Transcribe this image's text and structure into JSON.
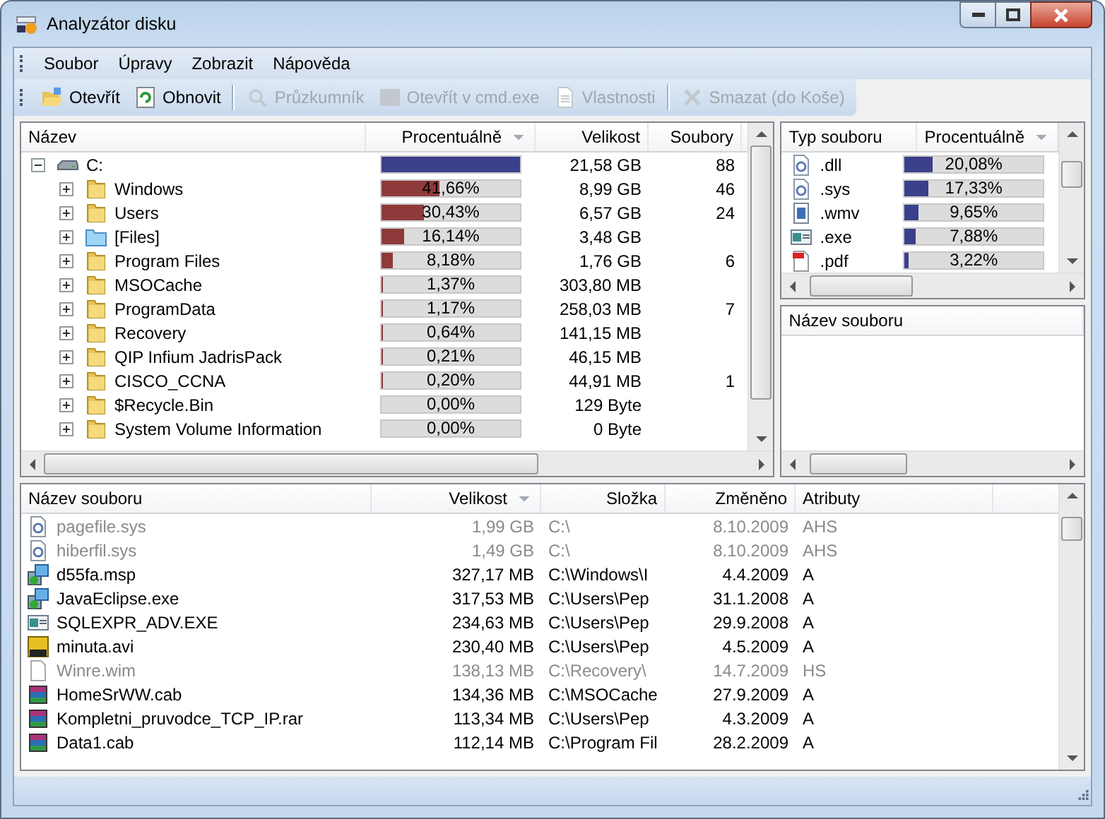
{
  "window": {
    "title": "Analyzátor disku"
  },
  "menu": [
    {
      "label": "Soubor"
    },
    {
      "label": "Úpravy"
    },
    {
      "label": "Zobrazit"
    },
    {
      "label": "Nápověda"
    }
  ],
  "toolbar": [
    {
      "kind": "open",
      "label": "Otevřít",
      "disabled": false
    },
    {
      "kind": "refresh",
      "label": "Obnovit",
      "disabled": false
    },
    {
      "kind": "separator"
    },
    {
      "kind": "explorer",
      "label": "Průzkumník",
      "disabled": true
    },
    {
      "kind": "console",
      "label": "Otevřít v cmd.exe",
      "disabled": true
    },
    {
      "kind": "properties",
      "label": "Vlastnosti",
      "disabled": true
    },
    {
      "kind": "separator"
    },
    {
      "kind": "delete",
      "label": "Smazat (do Koše)",
      "disabled": true
    }
  ],
  "tree": {
    "columns": [
      {
        "label": "Název",
        "sorted": false
      },
      {
        "label": "Procentuálně",
        "sorted": true
      },
      {
        "label": "Velikost",
        "sorted": false
      },
      {
        "label": "Soubory",
        "sorted": false
      }
    ],
    "items": [
      {
        "kind": "drive",
        "name": "C:",
        "level": 1,
        "size": "21,58 GB",
        "files": "88",
        "expanded": true,
        "children": [
          {
            "kind": "folder",
            "name": "Windows",
            "percent": "41,66%",
            "level": 0.4166,
            "size": "8,99 GB",
            "files": "46",
            "expanded": false
          },
          {
            "kind": "folder",
            "name": "Users",
            "percent": "30,43%",
            "level": 0.3043,
            "size": "6,57 GB",
            "files": "24",
            "expanded": false
          },
          {
            "kind": "files",
            "name": "[Files]",
            "percent": "16,14%",
            "level": 0.1614,
            "size": "3,48 GB",
            "expanded": false
          },
          {
            "kind": "folder",
            "name": "Program Files",
            "percent": "8,18%",
            "level": 0.0818,
            "size": "1,76 GB",
            "files": "6",
            "expanded": false
          },
          {
            "kind": "folder",
            "name": "MSOCache",
            "percent": "1,37%",
            "level": 0.0137,
            "size": "303,80 MB",
            "expanded": false
          },
          {
            "kind": "folder",
            "name": "ProgramData",
            "percent": "1,17%",
            "level": 0.0117,
            "size": "258,03 MB",
            "files": "7",
            "expanded": false
          },
          {
            "kind": "folder",
            "name": "Recovery",
            "percent": "0,64%",
            "level": 0.0064,
            "size": "141,15 MB",
            "expanded": false
          },
          {
            "kind": "folder",
            "name": "QIP Infium JadrisPack",
            "percent": "0,21%",
            "level": 0.0021,
            "size": "46,15 MB",
            "expanded": false
          },
          {
            "kind": "folder",
            "name": "CISCO_CCNA",
            "percent": "0,20%",
            "level": 0.002,
            "size": "44,91 MB",
            "files": "1",
            "expanded": false
          },
          {
            "kind": "folder",
            "name": "$Recycle.Bin",
            "percent": "0,00%",
            "level": 0,
            "size": "129 Byte",
            "expanded": false
          },
          {
            "kind": "folder",
            "name": "System Volume Information",
            "percent": "0,00%",
            "level": 0,
            "size": "0 Byte",
            "expanded": false
          }
        ]
      }
    ]
  },
  "types": {
    "columns": [
      {
        "label": "Typ souboru",
        "sorted": false
      },
      {
        "label": "Procentuálně",
        "sorted": true
      }
    ],
    "rows": [
      {
        "kind": "system",
        "ext": ".dll",
        "percent": "20,08%",
        "level": 0.2008
      },
      {
        "kind": "system",
        "ext": ".sys",
        "percent": "17,33%",
        "level": 0.1733
      },
      {
        "kind": "video",
        "ext": ".wmv",
        "percent": "9,65%",
        "level": 0.0965
      },
      {
        "kind": "program",
        "ext": ".exe",
        "percent": "7,88%",
        "level": 0.0788
      },
      {
        "kind": "pdf",
        "ext": ".pdf",
        "percent": "3,22%",
        "level": 0.0322
      }
    ]
  },
  "type_files": {
    "columns": [
      {
        "label": "Název souboru",
        "sorted": false
      }
    ]
  },
  "files": {
    "columns": [
      {
        "label": "Název souboru",
        "sorted": false
      },
      {
        "label": "Velikost",
        "sorted": true
      },
      {
        "label": "Složka",
        "sorted": false
      },
      {
        "label": "Změněno",
        "sorted": false
      },
      {
        "label": "Atributy",
        "sorted": false
      }
    ],
    "rows": [
      {
        "kind": "system",
        "name": "pagefile.sys",
        "size": "1,99 GB",
        "folder": "C:\\",
        "modified": "8.10.2009",
        "attributes": "AHS",
        "dimmed": true
      },
      {
        "kind": "system",
        "name": "hiberfil.sys",
        "size": "1,49 GB",
        "folder": "C:\\",
        "modified": "8.10.2009",
        "attributes": "AHS",
        "dimmed": true
      },
      {
        "kind": "installer",
        "name": "d55fa.msp",
        "size": "327,17 MB",
        "folder": "C:\\Windows\\I",
        "modified": "4.4.2009",
        "attributes": "A",
        "dimmed": false
      },
      {
        "kind": "installer",
        "name": "JavaEclipse.exe",
        "size": "317,53 MB",
        "folder": "C:\\Users\\Pep",
        "modified": "31.1.2008",
        "attributes": "A",
        "dimmed": false
      },
      {
        "kind": "program",
        "name": "SQLEXPR_ADV.EXE",
        "size": "234,63 MB",
        "folder": "C:\\Users\\Pep",
        "modified": "29.9.2008",
        "attributes": "A",
        "dimmed": false
      },
      {
        "kind": "avi",
        "name": "minuta.avi",
        "size": "230,40 MB",
        "folder": "C:\\Users\\Pep",
        "modified": "4.5.2009",
        "attributes": "A",
        "dimmed": false
      },
      {
        "kind": "blank",
        "name": "Winre.wim",
        "size": "138,13 MB",
        "folder": "C:\\Recovery\\",
        "modified": "14.7.2009",
        "attributes": "HS",
        "dimmed": true
      },
      {
        "kind": "archive",
        "name": "HomeSrWW.cab",
        "size": "134,36 MB",
        "folder": "C:\\MSOCache",
        "modified": "27.9.2009",
        "attributes": "A",
        "dimmed": false
      },
      {
        "kind": "archive",
        "name": "Kompletni_pruvodce_TCP_IP.rar",
        "size": "113,34 MB",
        "folder": "C:\\Users\\Pep",
        "modified": "4.3.2009",
        "attributes": "A",
        "dimmed": false
      },
      {
        "kind": "archive",
        "name": "Data1.cab",
        "size": "112,14 MB",
        "folder": "C:\\Program Fil",
        "modified": "28.2.2009",
        "attributes": "A",
        "dimmed": false
      }
    ]
  }
}
